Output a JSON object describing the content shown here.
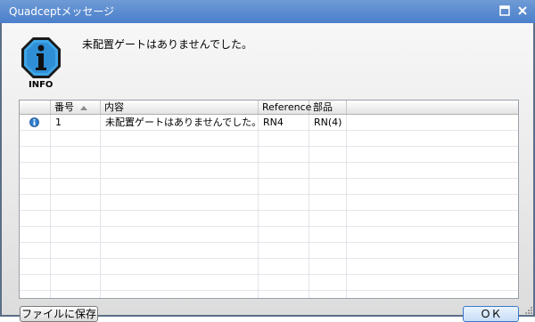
{
  "window": {
    "title": "Quadceptメッセージ",
    "icons": {
      "maximize": "maximize-icon",
      "close": "close-icon"
    },
    "colors": {
      "titlebar": "#4a7fcb",
      "accent": "#3b79c8"
    }
  },
  "header": {
    "icon": "info-icon",
    "icon_label": "INFO",
    "message": "未配置ゲートはありませんでした。"
  },
  "table": {
    "columns": [
      "",
      "番号",
      "内容",
      "Reference",
      "部品"
    ],
    "sorted_column": "番号",
    "sort_direction": "ascending",
    "rows": [
      {
        "icon": "info-icon",
        "number": "1",
        "content": "未配置ゲートはありませんでした。",
        "reference": "RN4",
        "part": "RN(4)"
      }
    ]
  },
  "buttons": {
    "save": "ファイルに保存",
    "ok": "ＯＫ"
  }
}
